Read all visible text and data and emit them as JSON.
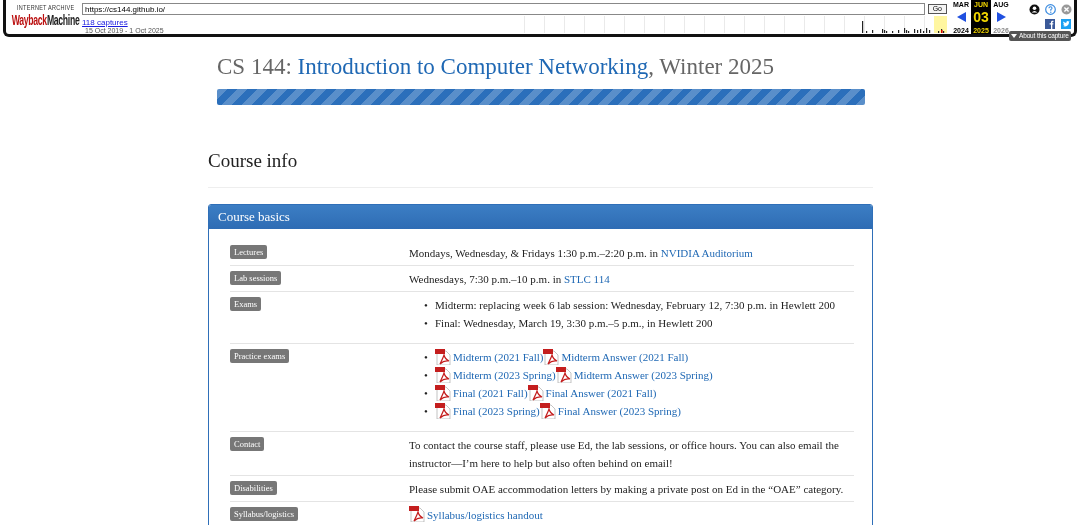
{
  "wayback": {
    "logo_top": "INTERNET ARCHIVE",
    "logo_red": "Wayback",
    "logo_black": "Machine",
    "url": "https://cs144.github.io/",
    "go": "Go",
    "captures": "118 captures",
    "range": "15 Oct 2019 - 1 Oct 2025",
    "calendar": [
      {
        "month": "MAR",
        "year": "2024",
        "selected": false,
        "year_disabled": false
      },
      {
        "month": "JUN",
        "day": "03",
        "year": "2025",
        "selected": true,
        "year_disabled": false
      },
      {
        "month": "AUG",
        "year": "2026",
        "selected": false,
        "year_disabled": true
      }
    ],
    "about": "About this capture"
  },
  "title": [
    {
      "text": "CS 144: ",
      "link": false
    },
    {
      "text": "Introduction to Computer Networking",
      "link": true
    },
    {
      "text": ", Winter 2025",
      "link": false
    }
  ],
  "section_heading": "Course info",
  "panel": {
    "heading": "Course basics",
    "rows": [
      {
        "label": "Lectures",
        "kind": "text",
        "parts": [
          {
            "text": "Mondays, Wednesday, & Fridays 1:30 p.m.–2:20 p.m. in ",
            "link": false
          },
          {
            "text": "NVIDIA Auditorium",
            "link": true
          }
        ]
      },
      {
        "label": "Lab sessions",
        "kind": "text",
        "parts": [
          {
            "text": "Wednesdays, 7:30 p.m.–10 p.m. in ",
            "link": false
          },
          {
            "text": "STLC 114",
            "link": true
          }
        ]
      },
      {
        "label": "Exams",
        "kind": "bullets",
        "marker": "•",
        "items": [
          "Midterm: replacing week 6 lab session: Wednesday, February 12, 7:30 p.m. in Hewlett 200",
          "Final: Wednesday, March 19, 3:30 p.m.–5 p.m., in Hewlett 200"
        ]
      },
      {
        "label": "Practice exams",
        "kind": "pdf_bullets",
        "marker": "•",
        "items": [
          [
            "Midterm (2021 Fall)",
            "Midterm Answer (2021 Fall)"
          ],
          [
            "Midterm (2023 Spring)",
            "Midterm Answer (2023 Spring)"
          ],
          [
            "Final (2021 Fall)",
            "Final Answer (2021 Fall)"
          ],
          [
            "Final (2023 Spring)",
            "Final Answer (2023 Spring)"
          ]
        ]
      },
      {
        "label": "Contact",
        "kind": "text",
        "parts": [
          {
            "text": "To contact the course staff, please use Ed, the lab sessions, or office hours. You can also email the instructor—I’m here to help but also often behind on email!",
            "link": false
          }
        ]
      },
      {
        "label": "Disabilities",
        "kind": "text",
        "parts": [
          {
            "text": "Please submit OAE accommodation letters by making a private post on Ed in the “OAE” category.",
            "link": false
          }
        ]
      },
      {
        "label": "Syllabus/logistics",
        "kind": "pdf_links",
        "links": [
          "Syllabus/logistics handout"
        ]
      }
    ]
  }
}
